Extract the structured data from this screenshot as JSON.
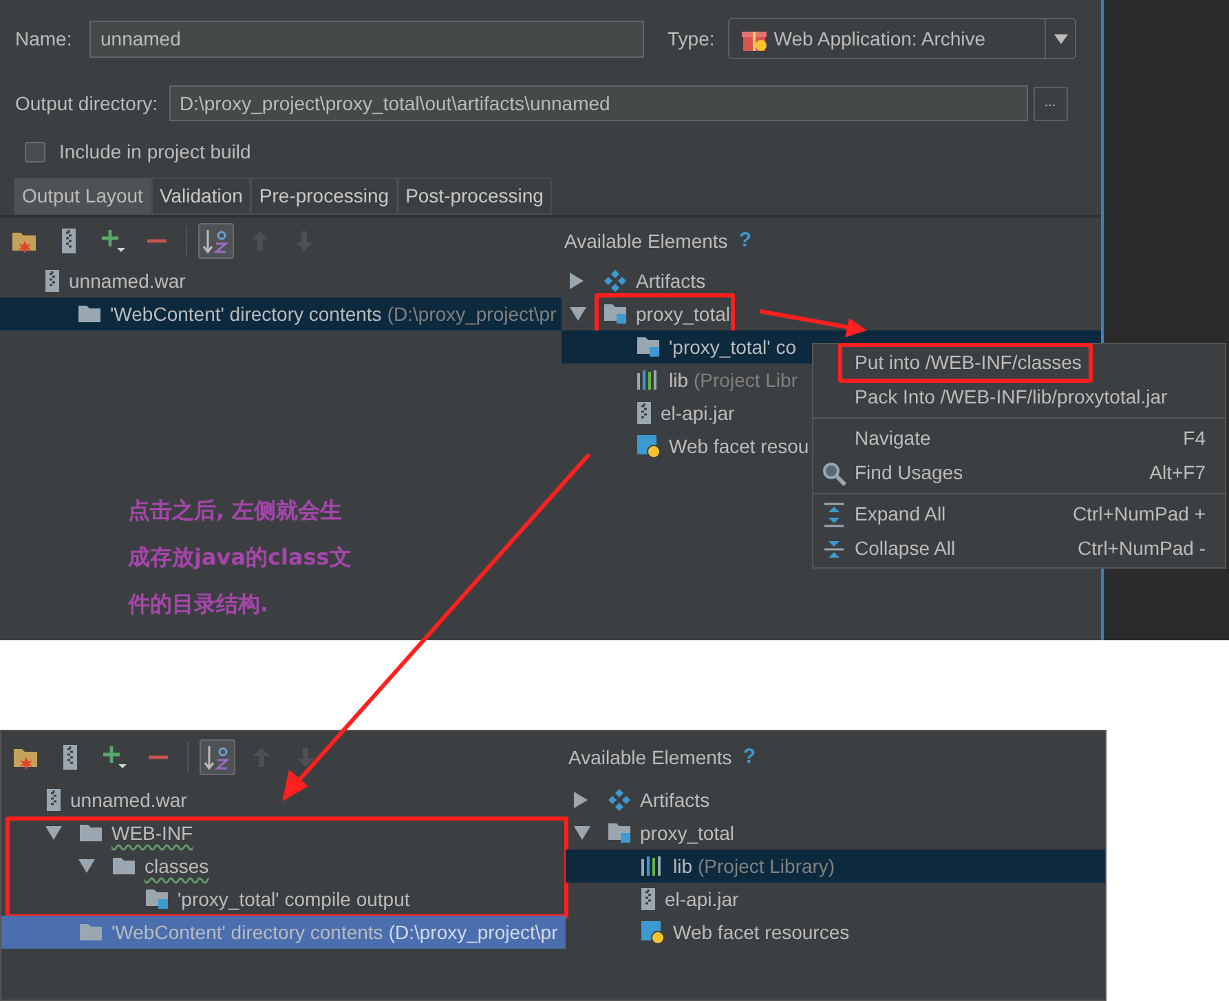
{
  "top_panel": {
    "name_field": {
      "label": "Name:",
      "value": "unnamed"
    },
    "type_field": {
      "label": "Type:",
      "value": "Web Application: Archive"
    },
    "output_directory": {
      "label": "Output directory:",
      "value": "D:\\proxy_project\\proxy_total\\out\\artifacts\\unnamed",
      "browse": "..."
    },
    "include_in_build": {
      "label": "Include in project build",
      "checked": false
    },
    "tabs": [
      {
        "label": "Output Layout",
        "selected": true
      },
      {
        "label": "Validation",
        "selected": false
      },
      {
        "label": "Pre-processing",
        "selected": false
      },
      {
        "label": "Post-processing",
        "selected": false
      }
    ],
    "toolbar": [
      {
        "kind": "add-folder",
        "disabled": false,
        "pressed": false
      },
      {
        "kind": "archive",
        "disabled": false,
        "pressed": false
      },
      {
        "kind": "add",
        "disabled": false,
        "pressed": false
      },
      {
        "kind": "remove",
        "disabled": false,
        "pressed": false
      },
      {
        "kind": "sort",
        "disabled": false,
        "pressed": true
      },
      {
        "kind": "up",
        "disabled": true,
        "pressed": false
      },
      {
        "kind": "down",
        "disabled": true,
        "pressed": false
      }
    ],
    "available_title": "Available Elements",
    "help": "?",
    "layout_tree": {
      "focused": false,
      "nodes": [
        {
          "kind": "archive",
          "label": "unnamed.war",
          "selected": false,
          "children": [
            {
              "kind": "folder",
              "label": "'WebContent' directory contents",
              "detail": "(D:\\proxy_project\\pr",
              "selected": true
            }
          ]
        }
      ]
    },
    "elements_tree": {
      "focused": false,
      "nodes": [
        {
          "kind": "artifacts",
          "label": "Artifacts",
          "expanded": false,
          "selected": false
        },
        {
          "kind": "module",
          "label": "proxy_total",
          "expanded": true,
          "selected": false,
          "boxed": true,
          "children": [
            {
              "kind": "module",
              "label": "'proxy_total' co",
              "selected": true
            },
            {
              "kind": "library",
              "label": "lib",
              "detail": "(Project Libr",
              "selected": false
            },
            {
              "kind": "archive",
              "label": "el-api.jar",
              "selected": false
            },
            {
              "kind": "web",
              "label": "Web facet resou",
              "selected": false
            }
          ]
        }
      ]
    },
    "context_menu": [
      {
        "kind": "item",
        "label": "Put into /WEB-INF/classes",
        "boxed": true
      },
      {
        "kind": "item",
        "label": "Pack Into /WEB-INF/lib/proxytotal.jar"
      },
      {
        "kind": "separator"
      },
      {
        "kind": "item",
        "label": "Navigate",
        "shortcut": "F4"
      },
      {
        "kind": "search-item",
        "label": "Find Usages",
        "shortcut": "Alt+F7"
      },
      {
        "kind": "separator"
      },
      {
        "kind": "expand-item",
        "label": "Expand All",
        "shortcut": "Ctrl+NumPad +"
      },
      {
        "kind": "collapse-item",
        "label": "Collapse All",
        "shortcut": "Ctrl+NumPad -"
      }
    ],
    "annotation": {
      "lines": [
        "点击之后, 左侧就会生",
        "成存放java的class文",
        "件的目录结构."
      ]
    }
  },
  "bottom_panel": {
    "toolbar": [
      {
        "kind": "add-folder",
        "disabled": false,
        "pressed": false
      },
      {
        "kind": "archive",
        "disabled": false,
        "pressed": false
      },
      {
        "kind": "add",
        "disabled": false,
        "pressed": false
      },
      {
        "kind": "remove",
        "disabled": false,
        "pressed": false
      },
      {
        "kind": "sort",
        "disabled": false,
        "pressed": true
      },
      {
        "kind": "up",
        "disabled": true,
        "pressed": false
      },
      {
        "kind": "down",
        "disabled": true,
        "pressed": false
      }
    ],
    "available_title": "Available Elements",
    "help": "?",
    "layout_tree": {
      "focused": true,
      "nodes": [
        {
          "kind": "archive",
          "label": "unnamed.war",
          "selected": false,
          "children": [
            {
              "kind": "folder",
              "label": "WEB-INF",
              "expanded": true,
              "misspelled": true,
              "selected": false,
              "boxed_with_children": true,
              "children": [
                {
                  "kind": "folder",
                  "label": "classes",
                  "expanded": true,
                  "misspelled": true,
                  "selected": false,
                  "children": [
                    {
                      "kind": "module",
                      "label": "'proxy_total' compile output",
                      "selected": false
                    }
                  ]
                }
              ]
            },
            {
              "kind": "folder",
              "label": "'WebContent' directory contents",
              "detail": "(D:\\proxy_project\\pr",
              "selected": true
            }
          ]
        }
      ]
    },
    "elements_tree": {
      "focused": false,
      "nodes": [
        {
          "kind": "artifacts",
          "label": "Artifacts",
          "expanded": false,
          "selected": false
        },
        {
          "kind": "module",
          "label": "proxy_total",
          "expanded": true,
          "selected": false,
          "children": [
            {
              "kind": "library",
              "label": "lib",
              "detail": "(Project Library)",
              "selected": true
            },
            {
              "kind": "archive",
              "label": "el-api.jar",
              "selected": false
            },
            {
              "kind": "web",
              "label": "Web facet resources",
              "selected": false
            }
          ]
        }
      ]
    }
  }
}
